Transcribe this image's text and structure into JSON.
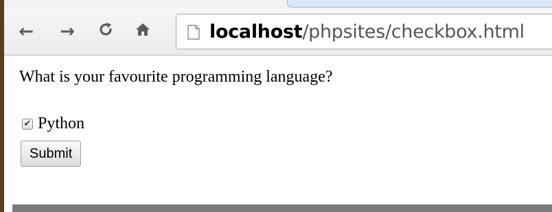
{
  "browser": {
    "url_host": "localhost",
    "url_path": "/phpsites/checkbox.html",
    "icons": {
      "back": "back-arrow-icon",
      "forward": "forward-arrow-icon",
      "reload": "reload-icon",
      "home": "home-icon",
      "page": "page-icon"
    }
  },
  "page": {
    "question": "What is your favourite programming language?",
    "options": [
      {
        "label": "Python",
        "checked": true
      }
    ],
    "submit_label": "Submit"
  }
}
